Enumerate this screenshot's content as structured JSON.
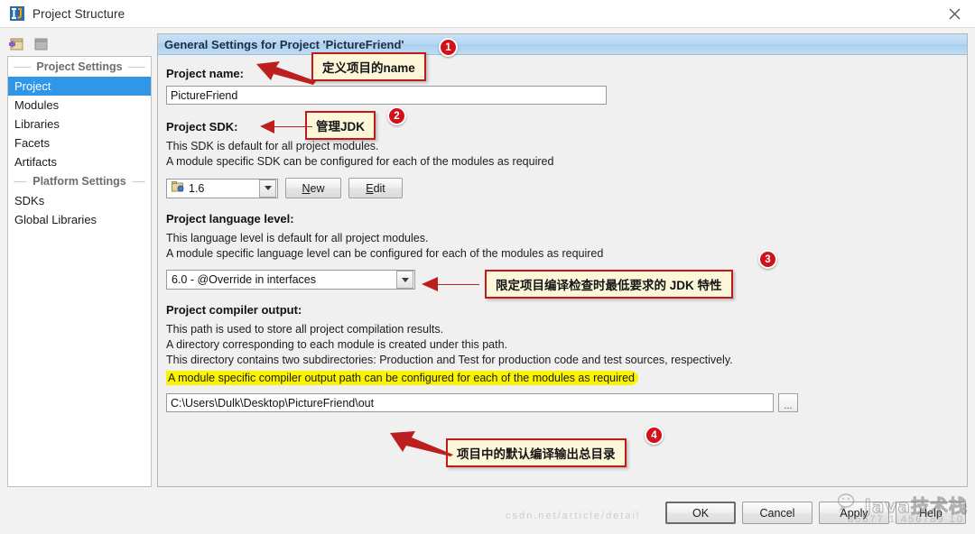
{
  "window": {
    "title": "Project Structure",
    "logo_icon": "intellij-idea-logo-icon",
    "close_icon": "close-icon"
  },
  "toolbar": {
    "add_icon": "add-module-icon",
    "remove_icon": "remove-module-icon"
  },
  "sidebar": {
    "sections": [
      {
        "title": "Project Settings",
        "items": [
          {
            "label": "Project",
            "selected": true
          },
          {
            "label": "Modules",
            "selected": false
          },
          {
            "label": "Libraries",
            "selected": false
          },
          {
            "label": "Facets",
            "selected": false
          },
          {
            "label": "Artifacts",
            "selected": false
          }
        ]
      },
      {
        "title": "Platform Settings",
        "items": [
          {
            "label": "SDKs",
            "selected": false
          },
          {
            "label": "Global Libraries",
            "selected": false
          }
        ]
      }
    ]
  },
  "panel": {
    "header": "General Settings for Project 'PictureFriend'",
    "project_name": {
      "label": "Project name:",
      "value": "PictureFriend"
    },
    "project_sdk": {
      "label": "Project SDK:",
      "desc1": "This SDK is default for all project modules.",
      "desc2": "A module specific SDK can be configured for each of the modules as required",
      "selected": "1.6",
      "sdk_icon": "jdk-folder-icon",
      "dropdown_icon": "chevron-down-icon",
      "new_button": "New",
      "new_mnemonic": "N",
      "edit_button": "Edit",
      "edit_mnemonic": "E"
    },
    "language_level": {
      "label": "Project language level:",
      "desc1": "This language level is default for all project modules.",
      "desc2": "A module specific language level can be configured for each of the modules as required",
      "selected": "6.0 - @Override in interfaces",
      "dropdown_icon": "chevron-down-icon"
    },
    "compiler_output": {
      "label": "Project compiler output:",
      "desc1": "This path is used to store all project compilation results.",
      "desc2": "A directory corresponding to each module is created under this path.",
      "desc3": "This directory contains two subdirectories: Production and Test for production code and test sources, respectively.",
      "highlighted": "A module specific compiler output path can be configured for each of the modules as required",
      "highlight_color": "#fbf400",
      "value": "C:\\Users\\Dulk\\Desktop\\PictureFriend\\out",
      "browse_button": "...",
      "browse_icon": "ellipsis-browse-icon"
    }
  },
  "annotations": {
    "box_bg": "#fdf6d8",
    "box_border": "#c01a1a",
    "badge_color": "#d0121b",
    "items": [
      {
        "number": "1",
        "text": "定义项目的name"
      },
      {
        "number": "2",
        "text": "管理JDK"
      },
      {
        "number": "3",
        "text": "限定项目编译检查时最低要求的 JDK 特性"
      },
      {
        "number": "4",
        "text": "项目中的默认编译输出总目录"
      }
    ]
  },
  "footer": {
    "buttons": [
      {
        "label": "OK",
        "primary": true
      },
      {
        "label": "Cancel",
        "primary": false
      },
      {
        "label": "Apply",
        "primary": false
      },
      {
        "label": "Help",
        "primary": false
      }
    ]
  },
  "watermark": {
    "brand": "Java技术栈",
    "logo_icon": "wechat-logo-icon",
    "url_right": "85677 1 456789 10",
    "url_left": "csdn.net/article/detail"
  }
}
